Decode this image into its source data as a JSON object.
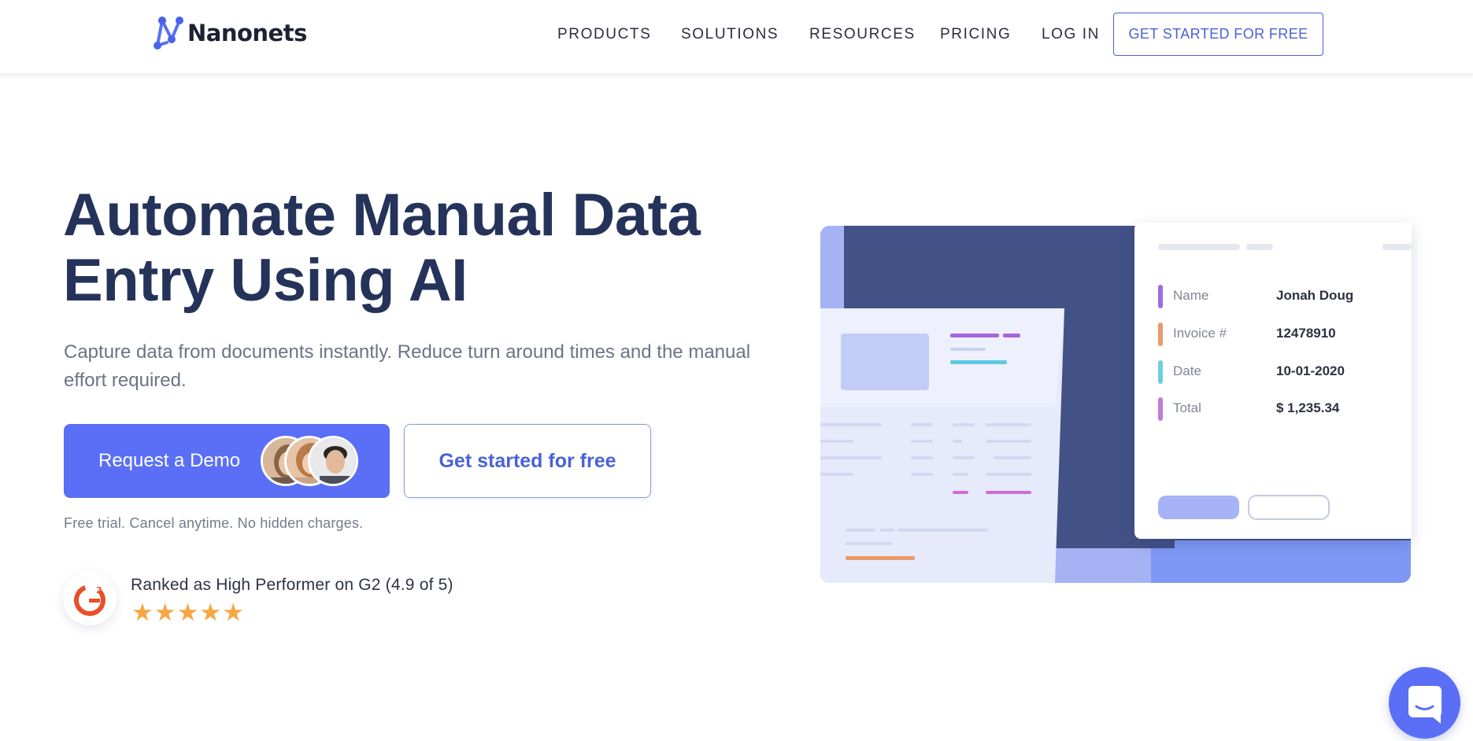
{
  "brand": {
    "name": "Nanonets",
    "logo_icon": "nanonets-network-icon",
    "accent_color": "#5a6ff6"
  },
  "nav": {
    "items": [
      {
        "label": "PRODUCTS"
      },
      {
        "label": "SOLUTIONS"
      },
      {
        "label": "RESOURCES"
      },
      {
        "label": "PRICING"
      },
      {
        "label": "LOG IN"
      }
    ],
    "cta_label": "GET STARTED FOR FREE"
  },
  "hero": {
    "headline_line1": "Automate Manual Data",
    "headline_line2": "Entry Using AI",
    "subhead": "Capture data from documents instantly. Reduce turn around times and the manual effort required.",
    "demo_button_label": "Request a Demo",
    "free_button_label": "Get started for free",
    "note": "Free trial. Cancel anytime. No hidden charges."
  },
  "rating": {
    "text": "Ranked as High Performer on G2 (4.9 of 5)",
    "stars": 5,
    "badge_icon": "g2-logo-icon"
  },
  "illustration": {
    "fields": [
      {
        "label": "Name",
        "value": "Jonah Doug",
        "color": "#9b6ee0"
      },
      {
        "label": "Invoice #",
        "value": "12478910",
        "color": "#e99a6b"
      },
      {
        "label": "Date",
        "value": "10-01-2020",
        "color": "#6fcde2"
      },
      {
        "label": "Total",
        "value": "$ 1,235.34",
        "color": "#c07bdc"
      }
    ]
  },
  "chat": {
    "icon": "chat-bubble-icon"
  }
}
